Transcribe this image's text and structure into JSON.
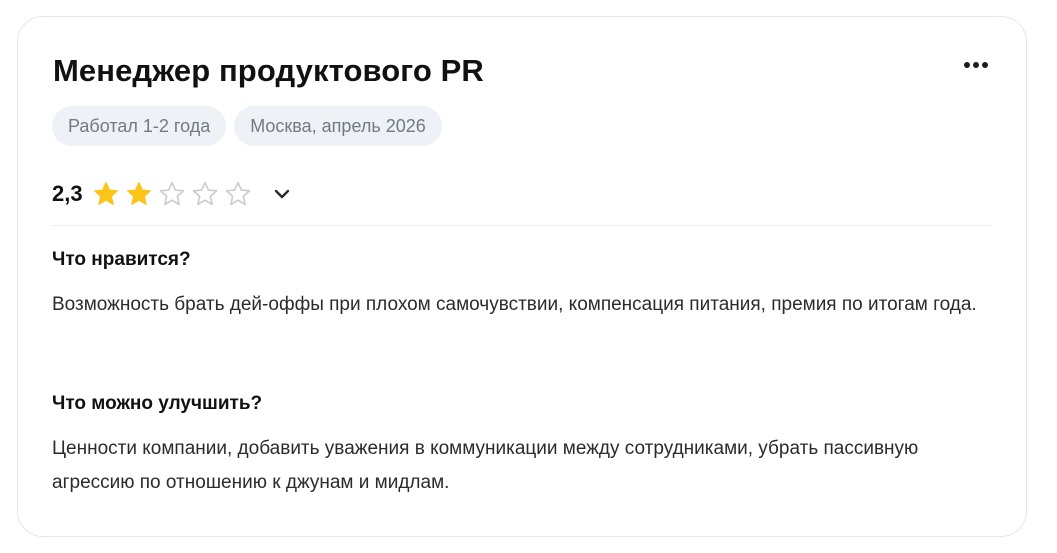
{
  "review": {
    "title": "Менеджер продуктового PR",
    "tags": [
      "Работал 1-2 года",
      "Москва, апрель 2026"
    ],
    "rating": {
      "value_label": "2,3",
      "value": 2.3,
      "max": 5,
      "filled_stars": 2
    },
    "sections": [
      {
        "title": "Что нравится?",
        "text": "Возможность брать дей-оффы при плохом самочувствии, компенсация питания, премия по итогам года."
      },
      {
        "title": "Что можно улучшить?",
        "text": "Ценности компании, добавить уважения в коммуникации между сотрудниками, убрать пассивную агрессию по отношению к джунам и мидлам."
      }
    ]
  },
  "icons": {
    "more": "more-horizontal-icon",
    "star_filled": "star-filled-icon",
    "star_empty": "star-outline-icon",
    "chevron": "chevron-down-icon"
  },
  "colors": {
    "star_filled": "#fcc419",
    "star_empty": "#c9ccd1",
    "tag_bg": "#eef1f5",
    "tag_text": "#727a86"
  }
}
